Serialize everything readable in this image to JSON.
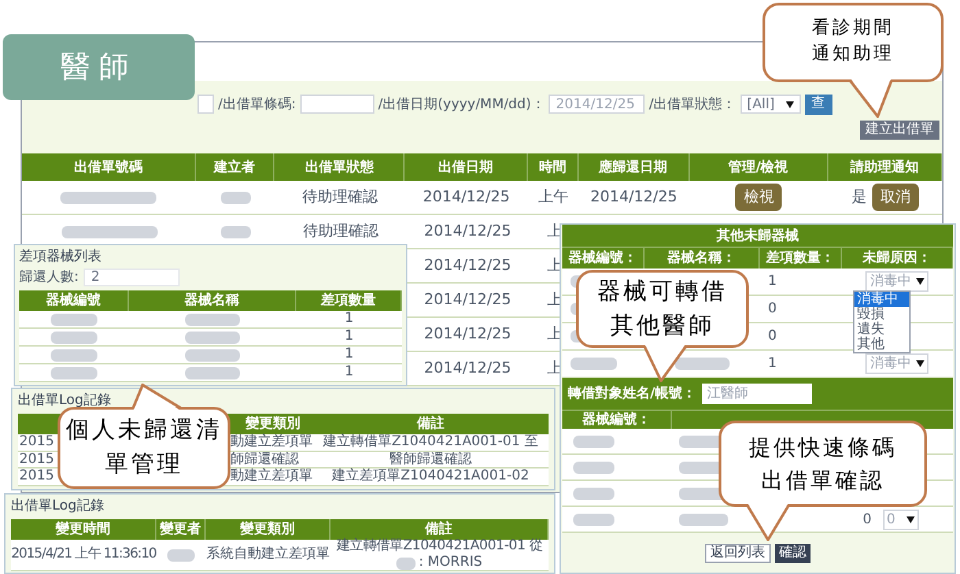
{
  "badge": {
    "title": "醫師"
  },
  "filter_bar": {
    "fields": [
      {
        "kind": "input"
      },
      {
        "kind": "input",
        "label": "/出借單條碼:"
      },
      {
        "kind": "input",
        "label": "/出借日期(yyyy/MM/dd)：",
        "value": "2014/12/25"
      },
      {
        "kind": "select",
        "label": "/出借單狀態：",
        "value": "[All]"
      }
    ],
    "search_button": "查",
    "create_button": "建立出借單"
  },
  "orders_table": {
    "columns": [
      "出借單號碼",
      "建立者",
      "出借單狀態",
      "出借日期",
      "時間",
      "應歸還日期",
      "管理/檢視",
      "請助理通知"
    ],
    "rows": [
      {
        "cells": [
          {
            "kind": "blurred"
          },
          {
            "kind": "blurred"
          },
          {
            "kind": "text",
            "text": "待助理確認"
          },
          {
            "kind": "text",
            "text": "2014/12/25"
          },
          {
            "kind": "text",
            "text": "上午"
          },
          {
            "kind": "text",
            "text": "2014/12/25"
          },
          {
            "kind": "button",
            "text": "檢視"
          },
          {
            "kind": "notify",
            "text": "是",
            "button": "取消"
          }
        ]
      },
      {
        "cells": [
          {
            "kind": "blurred"
          },
          {
            "kind": "blurred"
          },
          {
            "kind": "text",
            "text": "待助理確認"
          },
          {
            "kind": "text",
            "text": "2014/12/25"
          },
          {
            "kind": "text",
            "text": "上"
          }
        ]
      },
      {
        "cells": [
          {
            "kind": "blank"
          },
          {
            "kind": "blank"
          },
          {
            "kind": "blank"
          },
          {
            "kind": "text",
            "text": "2014/12/25"
          },
          {
            "kind": "text",
            "text": "上"
          }
        ]
      },
      {
        "cells": [
          {
            "kind": "blank"
          },
          {
            "kind": "blank"
          },
          {
            "kind": "blank"
          },
          {
            "kind": "text",
            "text": "2014/12/25"
          },
          {
            "kind": "text",
            "text": "上"
          }
        ]
      },
      {
        "cells": [
          {
            "kind": "blank"
          },
          {
            "kind": "blank"
          },
          {
            "kind": "blank"
          },
          {
            "kind": "text",
            "text": "2014/12/25"
          },
          {
            "kind": "text",
            "text": "上"
          }
        ]
      },
      {
        "cells": [
          {
            "kind": "blank"
          },
          {
            "kind": "blank"
          },
          {
            "kind": "blank"
          },
          {
            "kind": "text",
            "text": "2014/12/25"
          },
          {
            "kind": "text",
            "text": "上"
          }
        ]
      }
    ]
  },
  "shortage_panel": {
    "title": "差項器械列表",
    "count_label": "歸還人數:",
    "count_value": "2",
    "columns": [
      "器械編號",
      "器械名稱",
      "差項數量"
    ],
    "rows": [
      {
        "quantity": "1"
      },
      {
        "quantity": "1"
      },
      {
        "quantity": "1"
      },
      {
        "quantity": "1"
      }
    ]
  },
  "log_panel": {
    "title": "出借單Log記錄",
    "columns": [
      "變更類別",
      "備註"
    ],
    "rows": [
      {
        "time": "2015",
        "type": "動建立差項單",
        "note": "建立轉借單Z1040421A001-01 至"
      },
      {
        "time": "2015",
        "type": "師歸還確認",
        "note": "醫師歸還確認"
      },
      {
        "time": "2015",
        "type": "動建立差項單",
        "note": "建立差項單Z1040421A001-02"
      }
    ]
  },
  "log_panel_2": {
    "title": "出借單Log記錄",
    "columns": [
      "變更時間",
      "變更者",
      "變更類別",
      "備註"
    ],
    "rows": [
      {
        "time": "2015/4/21 上午 11:36:10",
        "type": "系統自動建立差項單",
        "note": "建立轉借單Z1040421A001-01 從",
        "note_end": ": MORRIS"
      }
    ]
  },
  "other_items_panel": {
    "title": "其他未歸器械",
    "columns": [
      "器械編號：",
      "器械名稱：",
      "差項數量：",
      "未歸原因："
    ],
    "rows": [
      {
        "quantity": "1",
        "reason": "消毒中"
      },
      {
        "quantity": "0"
      },
      {
        "quantity": "0"
      },
      {
        "quantity": "1",
        "reason": "消毒中"
      }
    ],
    "reason_options": [
      {
        "label": "消毒中",
        "selected": true
      },
      {
        "label": "毀損",
        "selected": false
      },
      {
        "label": "遺失",
        "selected": false
      },
      {
        "label": "其他",
        "selected": false
      }
    ],
    "transfer_label": "轉借對象姓名/帳號：",
    "transfer_value": "江醫師",
    "transfer_columns": [
      "器械編號："
    ],
    "transfer_rows": [
      {
        "kind": "blurred"
      },
      {
        "kind": "blurred"
      },
      {
        "kind": "blurred"
      },
      {
        "kind": "quantity",
        "quantity": "0",
        "select": "0"
      }
    ],
    "buttons": [
      {
        "kind": "secondary",
        "label": "返回列表"
      },
      {
        "kind": "primary",
        "label": "確認"
      }
    ]
  },
  "callouts": [
    {
      "lines": [
        "看診期間",
        "通知助理"
      ]
    },
    {
      "lines": [
        "器械可轉借",
        "其他醫師"
      ]
    },
    {
      "lines": [
        "個人未歸還清",
        "單管理"
      ]
    },
    {
      "lines": [
        "提供快速條碼",
        "出借單確認"
      ]
    }
  ]
}
